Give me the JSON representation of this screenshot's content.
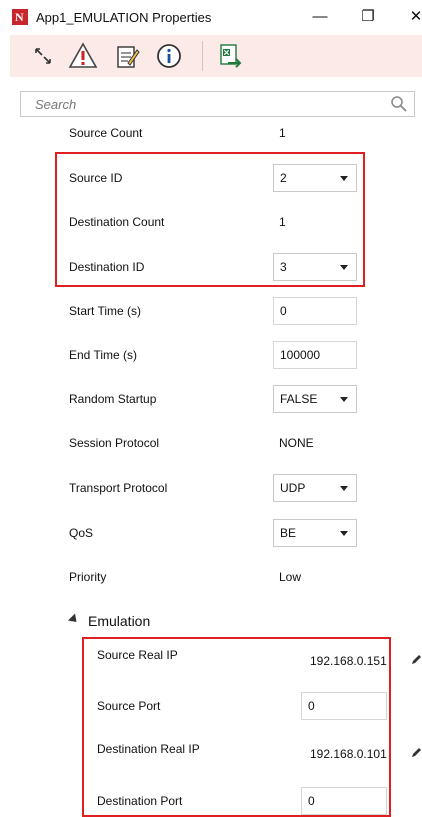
{
  "window": {
    "title": "App1_EMULATION Properties",
    "logo_letter": "N",
    "controls": {
      "minimize": "—",
      "restore": "❐",
      "close": "✕"
    }
  },
  "toolbar": {
    "items": [
      {
        "icon": "resize-arrows-icon"
      },
      {
        "icon": "warning-icon"
      },
      {
        "icon": "notepad-icon"
      },
      {
        "icon": "info-icon"
      },
      {
        "icon": "excel-export-icon"
      }
    ],
    "background": "#fbeae7"
  },
  "search": {
    "placeholder": "Search"
  },
  "properties": {
    "source_count": {
      "label": "Source Count",
      "value": "1"
    },
    "source_id": {
      "label": "Source ID",
      "value": "2"
    },
    "destination_count": {
      "label": "Destination Count",
      "value": "1"
    },
    "destination_id": {
      "label": "Destination ID",
      "value": "3"
    },
    "start_time": {
      "label": "Start Time (s)",
      "value": "0"
    },
    "end_time": {
      "label": "End Time (s)",
      "value": "100000"
    },
    "random_startup": {
      "label": "Random Startup",
      "value": "FALSE"
    },
    "session_protocol": {
      "label": "Session Protocol",
      "value": "NONE"
    },
    "transport_protocol": {
      "label": "Transport Protocol",
      "value": "UDP"
    },
    "qos": {
      "label": "QoS",
      "value": "BE"
    },
    "priority": {
      "label": "Priority",
      "value": "Low"
    }
  },
  "emulation": {
    "section_label": "Emulation",
    "source_real_ip": {
      "label": "Source Real IP",
      "value": "192.168.0.151"
    },
    "source_port": {
      "label": "Source Port",
      "value": "0"
    },
    "destination_real_ip": {
      "label": "Destination Real IP",
      "value": "192.168.0.101"
    },
    "destination_port": {
      "label": "Destination Port",
      "value": "0"
    }
  },
  "colors": {
    "highlight": "#e02020",
    "logo": "#c7262c"
  }
}
